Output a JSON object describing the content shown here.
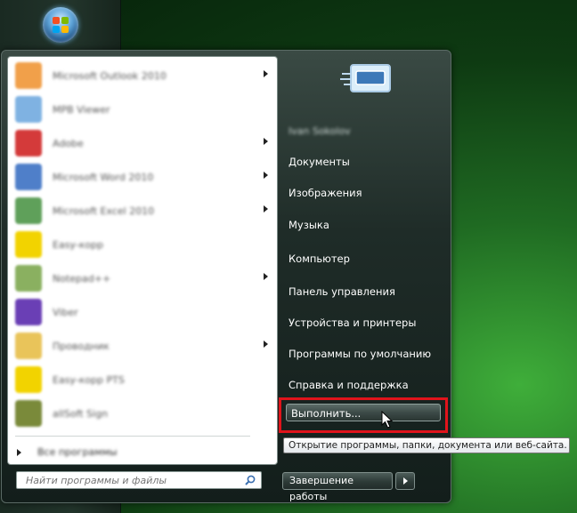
{
  "start_menu": {
    "programs": [
      {
        "label": "Microsoft Outlook 2010",
        "icon": "outlook-icon",
        "color": "#f1a04a",
        "has_submenu": true
      },
      {
        "label": "MPB Viewer",
        "icon": "viewer-icon",
        "color": "#7fb2e2",
        "has_submenu": false
      },
      {
        "label": "Adobe",
        "icon": "adobe-icon",
        "color": "#d43a3a",
        "has_submenu": true
      },
      {
        "label": "Microsoft Word 2010",
        "icon": "word-icon",
        "color": "#4f7fc9",
        "has_submenu": true
      },
      {
        "label": "Microsoft Excel 2010",
        "icon": "excel-icon",
        "color": "#5fa05a",
        "has_submenu": true
      },
      {
        "label": "Easy-корр",
        "icon": "easy-icon",
        "color": "#f2d300",
        "has_submenu": false
      },
      {
        "label": "Notepad++",
        "icon": "notepad-icon",
        "color": "#8ab060",
        "has_submenu": true
      },
      {
        "label": "Viber",
        "icon": "viber-icon",
        "color": "#6a3fb5",
        "has_submenu": false
      },
      {
        "label": "Проводник",
        "icon": "explorer-icon",
        "color": "#e9c45a",
        "has_submenu": true
      },
      {
        "label": "Easy-корр PTS",
        "icon": "easy-pts-icon",
        "color": "#f2d300",
        "has_submenu": false
      },
      {
        "label": "allSoft Sign",
        "icon": "sign-icon",
        "color": "#7a8a3a",
        "has_submenu": false
      }
    ],
    "all_programs_label": "Все программы",
    "search": {
      "placeholder": "Найти программы и файлы"
    },
    "user_name": "Ivan Sokolov",
    "right_items": [
      {
        "label": "Документы",
        "name": "documents"
      },
      {
        "label": "Изображения",
        "name": "pictures"
      },
      {
        "label": "Музыка",
        "name": "music"
      },
      {
        "label": "Компьютер",
        "name": "computer"
      },
      {
        "label": "Панель управления",
        "name": "control-panel"
      },
      {
        "label": "Устройства и принтеры",
        "name": "devices-printers"
      },
      {
        "label": "Программы по умолчанию",
        "name": "default-programs"
      },
      {
        "label": "Справка и поддержка",
        "name": "help-support"
      }
    ],
    "run_label": "Выполнить...",
    "tooltip": "Открытие программы, папки, документа или веб-сайта.",
    "shutdown_label": "Завершение работы"
  },
  "colors": {
    "highlight": "#e0141b",
    "accent": "#2d3a37"
  }
}
